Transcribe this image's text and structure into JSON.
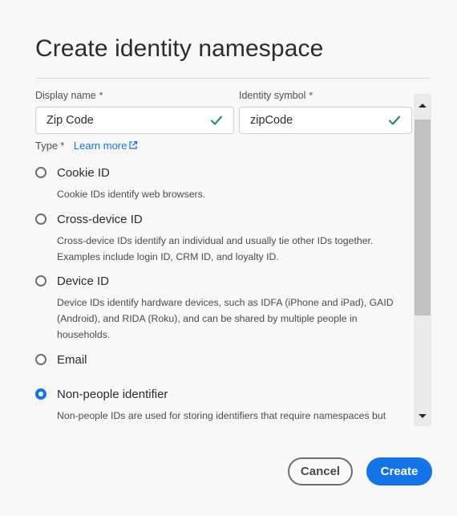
{
  "dialog": {
    "title": "Create identity namespace"
  },
  "fields": {
    "display_name": {
      "label": "Display name",
      "required_mark": "*",
      "value": "Zip Code"
    },
    "identity_symbol": {
      "label": "Identity symbol",
      "required_mark": "*",
      "value": "zipCode"
    }
  },
  "type": {
    "label": "Type",
    "required_mark": "*",
    "learn_more": "Learn more",
    "options": [
      {
        "label": "Cookie ID",
        "description": "Cookie IDs identify web browsers.",
        "selected": false
      },
      {
        "label": "Cross-device ID",
        "description": "Cross-device IDs identify an individual and usually tie other IDs together. Examples include login ID, CRM ID, and loyalty ID.",
        "selected": false
      },
      {
        "label": "Device ID",
        "description": "Device IDs identify hardware devices, such as IDFA (iPhone and iPad), GAID (Android), and RIDA (Roku), and can be shared by multiple people in households.",
        "selected": false
      },
      {
        "label": "Email",
        "description": "",
        "selected": false
      },
      {
        "label": "Non-people identifier",
        "description": "Non-people IDs are used for storing identifiers that require namespaces but",
        "selected": true
      }
    ]
  },
  "footer": {
    "cancel_label": "Cancel",
    "create_label": "Create"
  },
  "colors": {
    "accent": "#1473e6",
    "valid_check": "#268e6c"
  },
  "icons": {
    "check": "check-icon",
    "external_link": "external-link-icon",
    "scroll_up": "chevron-up-icon",
    "scroll_down": "chevron-down-icon"
  }
}
